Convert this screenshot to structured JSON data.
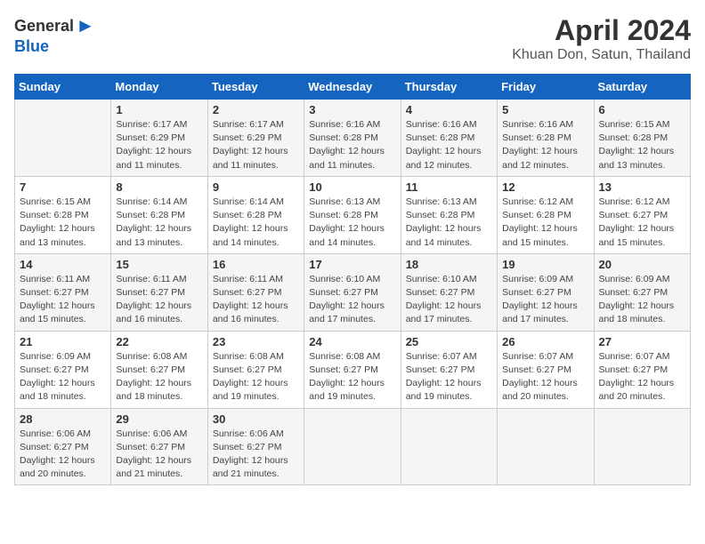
{
  "header": {
    "logo_general": "General",
    "logo_blue": "Blue",
    "title": "April 2024",
    "subtitle": "Khuan Don, Satun, Thailand"
  },
  "days_of_week": [
    "Sunday",
    "Monday",
    "Tuesday",
    "Wednesday",
    "Thursday",
    "Friday",
    "Saturday"
  ],
  "weeks": [
    [
      {
        "day": "",
        "info": ""
      },
      {
        "day": "1",
        "info": "Sunrise: 6:17 AM\nSunset: 6:29 PM\nDaylight: 12 hours\nand 11 minutes."
      },
      {
        "day": "2",
        "info": "Sunrise: 6:17 AM\nSunset: 6:29 PM\nDaylight: 12 hours\nand 11 minutes."
      },
      {
        "day": "3",
        "info": "Sunrise: 6:16 AM\nSunset: 6:28 PM\nDaylight: 12 hours\nand 11 minutes."
      },
      {
        "day": "4",
        "info": "Sunrise: 6:16 AM\nSunset: 6:28 PM\nDaylight: 12 hours\nand 12 minutes."
      },
      {
        "day": "5",
        "info": "Sunrise: 6:16 AM\nSunset: 6:28 PM\nDaylight: 12 hours\nand 12 minutes."
      },
      {
        "day": "6",
        "info": "Sunrise: 6:15 AM\nSunset: 6:28 PM\nDaylight: 12 hours\nand 13 minutes."
      }
    ],
    [
      {
        "day": "7",
        "info": "Sunrise: 6:15 AM\nSunset: 6:28 PM\nDaylight: 12 hours\nand 13 minutes."
      },
      {
        "day": "8",
        "info": "Sunrise: 6:14 AM\nSunset: 6:28 PM\nDaylight: 12 hours\nand 13 minutes."
      },
      {
        "day": "9",
        "info": "Sunrise: 6:14 AM\nSunset: 6:28 PM\nDaylight: 12 hours\nand 14 minutes."
      },
      {
        "day": "10",
        "info": "Sunrise: 6:13 AM\nSunset: 6:28 PM\nDaylight: 12 hours\nand 14 minutes."
      },
      {
        "day": "11",
        "info": "Sunrise: 6:13 AM\nSunset: 6:28 PM\nDaylight: 12 hours\nand 14 minutes."
      },
      {
        "day": "12",
        "info": "Sunrise: 6:12 AM\nSunset: 6:28 PM\nDaylight: 12 hours\nand 15 minutes."
      },
      {
        "day": "13",
        "info": "Sunrise: 6:12 AM\nSunset: 6:27 PM\nDaylight: 12 hours\nand 15 minutes."
      }
    ],
    [
      {
        "day": "14",
        "info": "Sunrise: 6:11 AM\nSunset: 6:27 PM\nDaylight: 12 hours\nand 15 minutes."
      },
      {
        "day": "15",
        "info": "Sunrise: 6:11 AM\nSunset: 6:27 PM\nDaylight: 12 hours\nand 16 minutes."
      },
      {
        "day": "16",
        "info": "Sunrise: 6:11 AM\nSunset: 6:27 PM\nDaylight: 12 hours\nand 16 minutes."
      },
      {
        "day": "17",
        "info": "Sunrise: 6:10 AM\nSunset: 6:27 PM\nDaylight: 12 hours\nand 17 minutes."
      },
      {
        "day": "18",
        "info": "Sunrise: 6:10 AM\nSunset: 6:27 PM\nDaylight: 12 hours\nand 17 minutes."
      },
      {
        "day": "19",
        "info": "Sunrise: 6:09 AM\nSunset: 6:27 PM\nDaylight: 12 hours\nand 17 minutes."
      },
      {
        "day": "20",
        "info": "Sunrise: 6:09 AM\nSunset: 6:27 PM\nDaylight: 12 hours\nand 18 minutes."
      }
    ],
    [
      {
        "day": "21",
        "info": "Sunrise: 6:09 AM\nSunset: 6:27 PM\nDaylight: 12 hours\nand 18 minutes."
      },
      {
        "day": "22",
        "info": "Sunrise: 6:08 AM\nSunset: 6:27 PM\nDaylight: 12 hours\nand 18 minutes."
      },
      {
        "day": "23",
        "info": "Sunrise: 6:08 AM\nSunset: 6:27 PM\nDaylight: 12 hours\nand 19 minutes."
      },
      {
        "day": "24",
        "info": "Sunrise: 6:08 AM\nSunset: 6:27 PM\nDaylight: 12 hours\nand 19 minutes."
      },
      {
        "day": "25",
        "info": "Sunrise: 6:07 AM\nSunset: 6:27 PM\nDaylight: 12 hours\nand 19 minutes."
      },
      {
        "day": "26",
        "info": "Sunrise: 6:07 AM\nSunset: 6:27 PM\nDaylight: 12 hours\nand 20 minutes."
      },
      {
        "day": "27",
        "info": "Sunrise: 6:07 AM\nSunset: 6:27 PM\nDaylight: 12 hours\nand 20 minutes."
      }
    ],
    [
      {
        "day": "28",
        "info": "Sunrise: 6:06 AM\nSunset: 6:27 PM\nDaylight: 12 hours\nand 20 minutes."
      },
      {
        "day": "29",
        "info": "Sunrise: 6:06 AM\nSunset: 6:27 PM\nDaylight: 12 hours\nand 21 minutes."
      },
      {
        "day": "30",
        "info": "Sunrise: 6:06 AM\nSunset: 6:27 PM\nDaylight: 12 hours\nand 21 minutes."
      },
      {
        "day": "",
        "info": ""
      },
      {
        "day": "",
        "info": ""
      },
      {
        "day": "",
        "info": ""
      },
      {
        "day": "",
        "info": ""
      }
    ]
  ]
}
